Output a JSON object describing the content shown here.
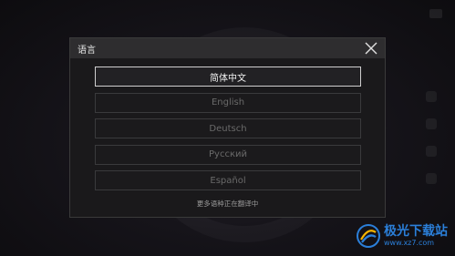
{
  "dialog": {
    "title": "语言",
    "close_icon": "close-icon",
    "languages": [
      {
        "label": "简体中文",
        "selected": true
      },
      {
        "label": "English",
        "selected": false
      },
      {
        "label": "Deutsch",
        "selected": false
      },
      {
        "label": "Русский",
        "selected": false
      },
      {
        "label": "Español",
        "selected": false
      }
    ],
    "more_note": "更多语种正在翻译中"
  },
  "watermark": {
    "name": "极光下载站",
    "url": "www.xz7.com",
    "icon": "aurora-logo-icon",
    "color": "#2b7fd9"
  }
}
